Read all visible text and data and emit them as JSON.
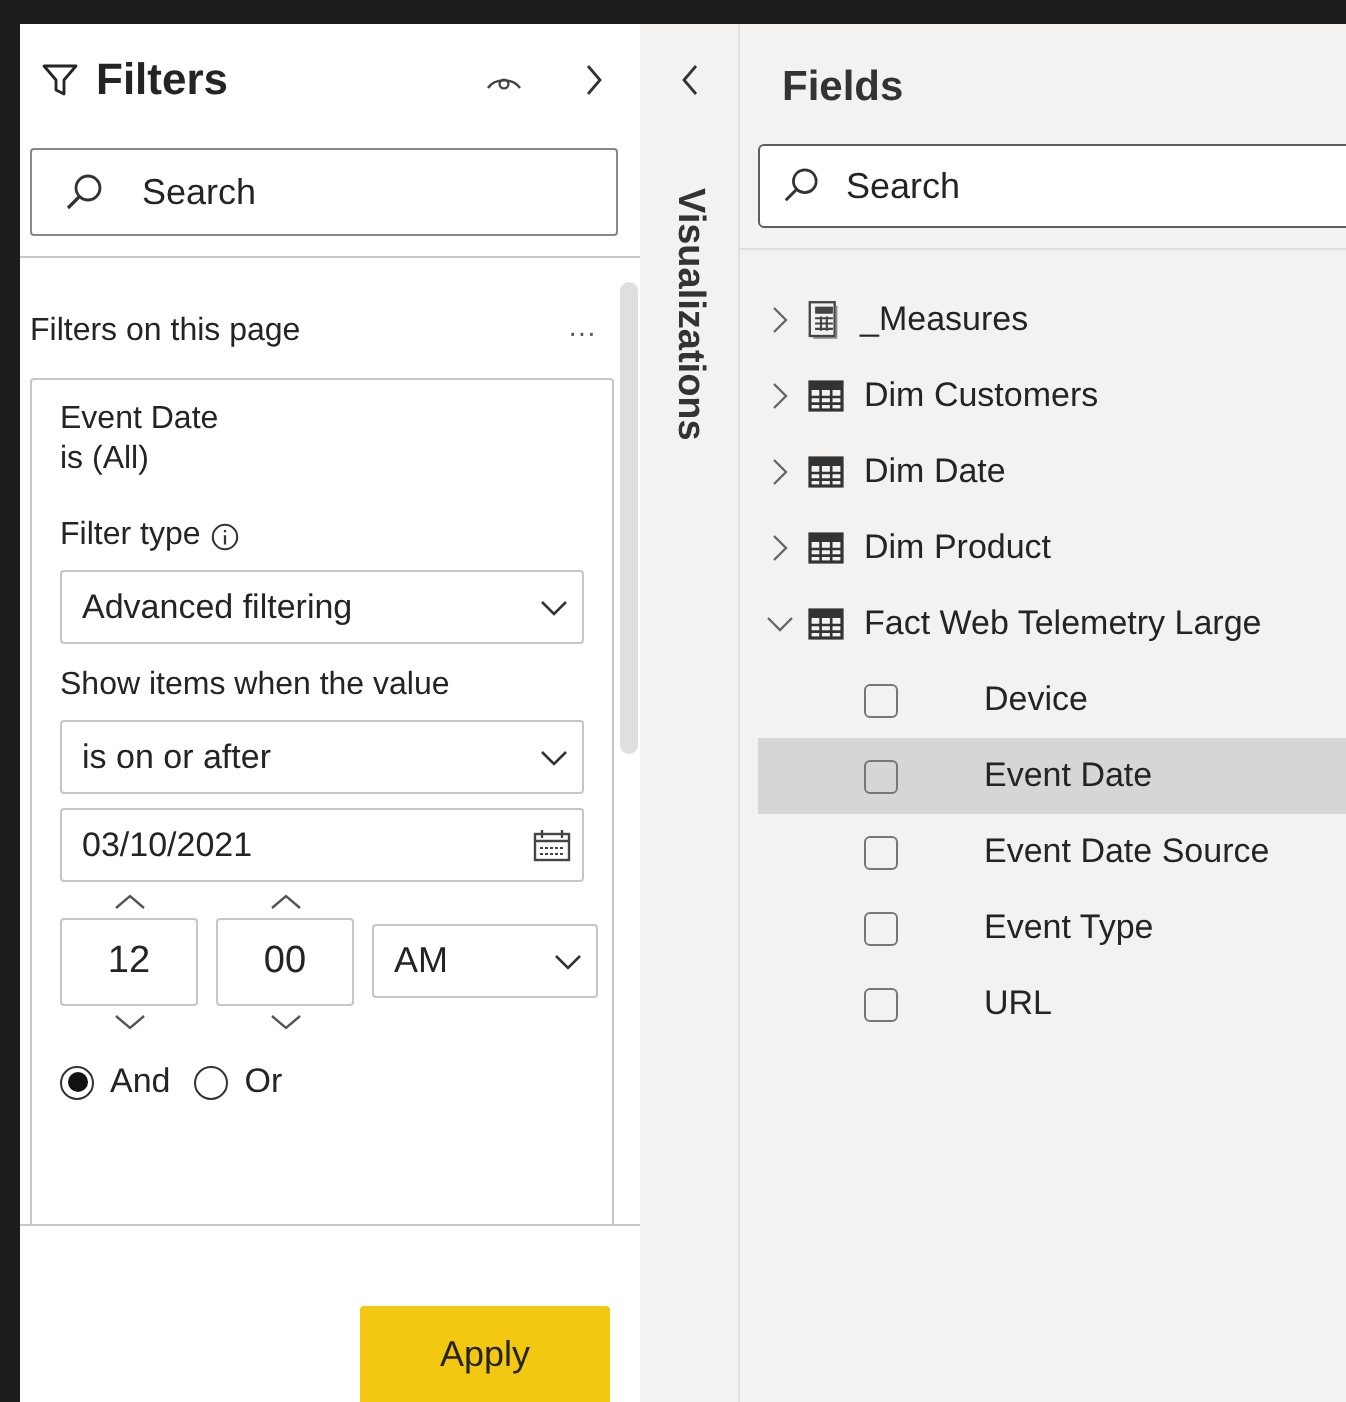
{
  "filters_pane": {
    "title": "Filters",
    "search": {
      "placeholder": "Search"
    },
    "section_title": "Filters on this page",
    "more": "···",
    "card": {
      "field": "Event Date",
      "summary": "is (All)",
      "filter_type_label": "Filter type",
      "filter_type": "Advanced filtering",
      "condition_label": "Show items when the value",
      "condition": "is on or after",
      "date": "03/10/2021",
      "hour": "12",
      "minute": "00",
      "period": "AM",
      "logic": [
        {
          "label": "And",
          "selected": true
        },
        {
          "label": "Or",
          "selected": false
        }
      ]
    },
    "apply": "Apply"
  },
  "visualizations_tab": {
    "label": "Visualizations"
  },
  "fields_pane": {
    "title": "Fields",
    "search": {
      "placeholder": "Search"
    },
    "tables": [
      {
        "name": "_Measures",
        "kind": "measures",
        "expanded": false
      },
      {
        "name": "Dim Customers",
        "kind": "table",
        "expanded": false
      },
      {
        "name": "Dim Date",
        "kind": "table",
        "expanded": false
      },
      {
        "name": "Dim Product",
        "kind": "table",
        "expanded": false
      },
      {
        "name": "Fact Web Telemetry Large",
        "kind": "table",
        "expanded": true,
        "children": [
          {
            "name": "Device",
            "checked": false,
            "selected": false
          },
          {
            "name": "Event Date",
            "checked": false,
            "selected": true
          },
          {
            "name": "Event Date Source",
            "checked": false,
            "selected": false
          },
          {
            "name": "Event Type",
            "checked": false,
            "selected": false
          },
          {
            "name": "URL",
            "checked": false,
            "selected": false
          }
        ]
      }
    ]
  }
}
